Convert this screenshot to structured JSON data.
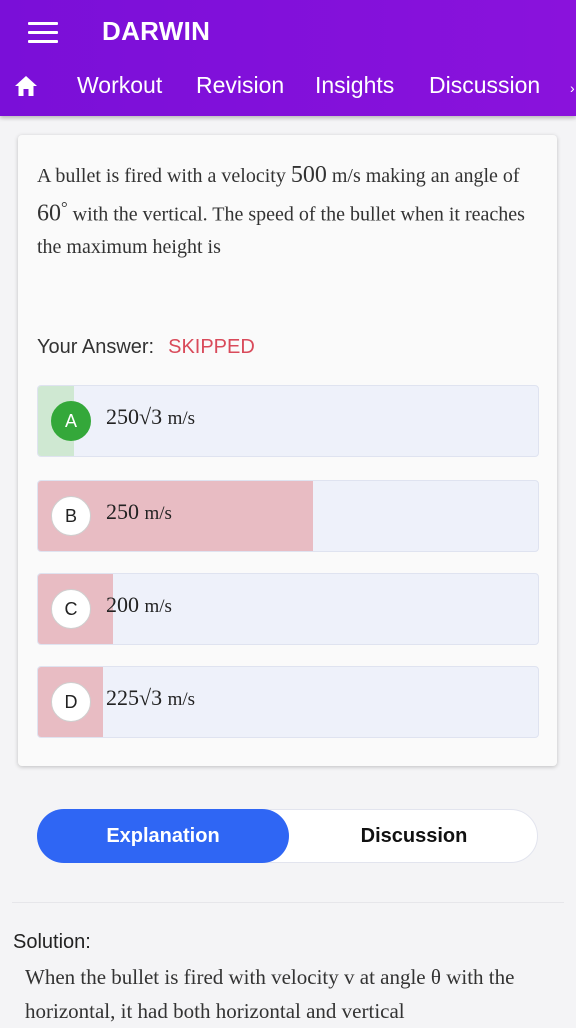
{
  "app": {
    "title": "DARWIN"
  },
  "nav": {
    "tabs": [
      "Workout",
      "Revision",
      "Insights",
      "Discussion"
    ]
  },
  "colors": {
    "header": "#7a0fd8",
    "correct": "#34a83a",
    "correct_fill": "#cfe8d2",
    "incorrect_fill": "#e8bcc3",
    "skipped": "#d94a5a",
    "accent": "#2f66f4"
  },
  "question": {
    "text_1": "A bullet is fired with a velocity ",
    "velocity": "500",
    "text_2": " m/s making an angle of ",
    "angle": "60",
    "degree": "°",
    "text_3": " with the vertical. The speed of the bullet when it reaches the maximum height is"
  },
  "answer": {
    "label": "Your Answer:",
    "value": "SKIPPED"
  },
  "options": [
    {
      "letter": "A",
      "value": "250",
      "radical": "√3",
      "unit": "m/s",
      "correct": true,
      "percent": 7
    },
    {
      "letter": "B",
      "value": "250",
      "radical": "",
      "unit": "m/s",
      "correct": false,
      "percent": 55
    },
    {
      "letter": "C",
      "value": "200",
      "radical": "",
      "unit": "m/s",
      "correct": false,
      "percent": 15
    },
    {
      "letter": "D",
      "value": "225",
      "radical": "√3",
      "unit": "m/s",
      "correct": false,
      "percent": 13
    }
  ],
  "tabs": {
    "explanation": "Explanation",
    "discussion": "Discussion"
  },
  "solution": {
    "heading": "Solution:",
    "text": "When the bullet is fired with velocity v at angle θ with the horizontal, it had both horizontal and vertical"
  }
}
